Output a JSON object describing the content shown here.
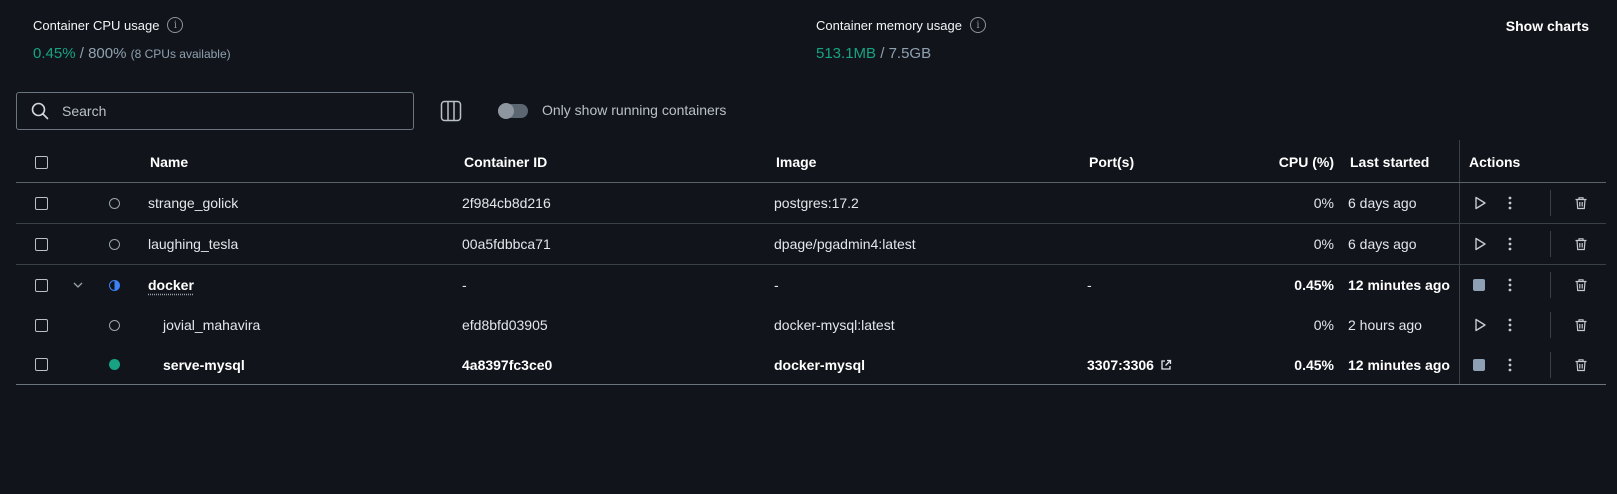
{
  "stats": {
    "cpu": {
      "title": "Container CPU usage",
      "used": "0.45%",
      "separator": " / ",
      "total": "800%",
      "note": "(8 CPUs available)"
    },
    "memory": {
      "title": "Container memory usage",
      "used": "513.1MB",
      "separator": " / ",
      "total": "7.5GB"
    },
    "show_charts": "Show charts"
  },
  "toolbar": {
    "search_placeholder": "Search",
    "toggle_label": "Only show running containers",
    "toggle_on": false
  },
  "table": {
    "headers": {
      "name": "Name",
      "container_id": "Container ID",
      "image": "Image",
      "ports": "Port(s)",
      "cpu": "CPU (%)",
      "last_started": "Last started",
      "actions": "Actions"
    },
    "rows": [
      {
        "name": "strange_golick",
        "container_id": "2f984cb8d216",
        "image": "postgres:17.2",
        "ports": "",
        "cpu": "0%",
        "last_started": "6 days ago",
        "status": "stopped"
      },
      {
        "name": "laughing_tesla",
        "container_id": "00a5fdbbca71",
        "image": "dpage/pgadmin4:latest",
        "ports": "",
        "cpu": "0%",
        "last_started": "6 days ago",
        "status": "stopped"
      },
      {
        "name": "docker",
        "container_id": "-",
        "image": "-",
        "ports": "-",
        "cpu": "0.45%",
        "last_started": "12 minutes ago",
        "status": "partial"
      },
      {
        "name": "jovial_mahavira",
        "container_id": "efd8bfd03905",
        "image": "docker-mysql:latest",
        "ports": "",
        "cpu": "0%",
        "last_started": "2 hours ago",
        "status": "stopped"
      },
      {
        "name": "serve-mysql",
        "container_id": "4a8397fc3ce0",
        "image": "docker-mysql",
        "ports": "3307:3306",
        "cpu": "0.45%",
        "last_started": "12 minutes ago",
        "status": "running"
      }
    ]
  },
  "icons": {
    "search": "search-icon",
    "info": "info-icon",
    "columns": "columns-icon",
    "play": "play-icon",
    "stop": "stop-icon",
    "more": "more-vertical-icon",
    "delete": "trash-icon",
    "chevron": "chevron-down-icon",
    "external": "external-link-icon"
  },
  "colors": {
    "background": "#11151b",
    "accent_green": "#17a383",
    "partial_blue": "#3b82f6"
  }
}
